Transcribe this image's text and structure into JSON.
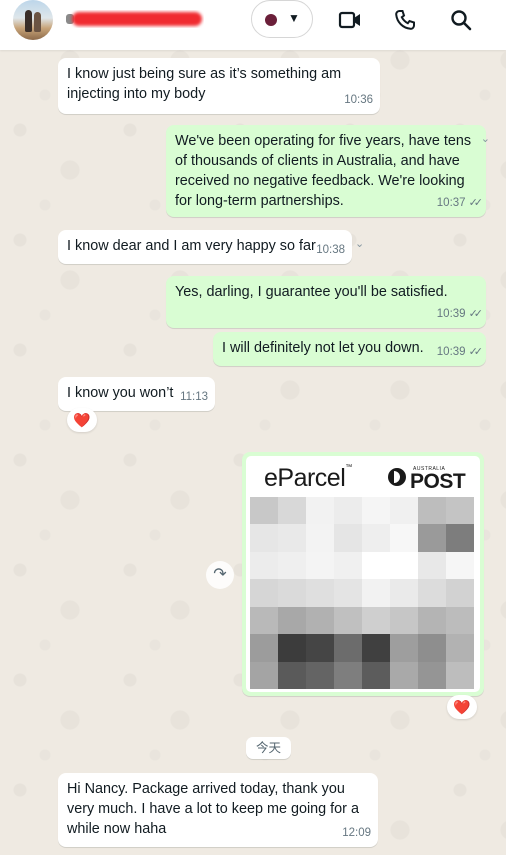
{
  "header": {
    "contact_name": "",
    "status_color": "#6b1f3a",
    "icons": [
      "video-call-icon",
      "voice-call-icon",
      "search-icon"
    ]
  },
  "messages": [
    {
      "direction": "in",
      "text": "I know just being sure as it’s something am injecting into my body",
      "time": "10:36"
    },
    {
      "direction": "out",
      "text": "We've been operating for five years, have tens of thousands of clients in Australia, and have received no negative feedback. We're looking for long-term partnerships.",
      "time": "10:37"
    },
    {
      "direction": "in",
      "text": "I know dear and I am very happy so far",
      "time": "10:38"
    },
    {
      "direction": "out",
      "text": "Yes, darling, I guarantee you'll be satisfied.",
      "time": "10:39"
    },
    {
      "direction": "out",
      "text": "I will definitely not let you down.",
      "time": "10:39"
    },
    {
      "direction": "in",
      "text": "I know you won’t",
      "time": "11:13",
      "reaction": "❤️"
    },
    {
      "direction": "in",
      "text": "Hi Nancy. Package arrived today, thank you very much. I have a lot to keep me going for a while now haha",
      "time": "12:09"
    }
  ],
  "image_message": {
    "brand_left": "eParcel",
    "brand_left_tm": "™",
    "brand_right_small": "AUSTRALIA",
    "brand_right": "POST",
    "reaction": "❤️"
  },
  "date_separator": "今天",
  "colors": {
    "incoming_bubble": "#ffffff",
    "outgoing_bubble": "#d9fdd3",
    "chat_background": "#efeae2",
    "meta_text": "#667781"
  }
}
